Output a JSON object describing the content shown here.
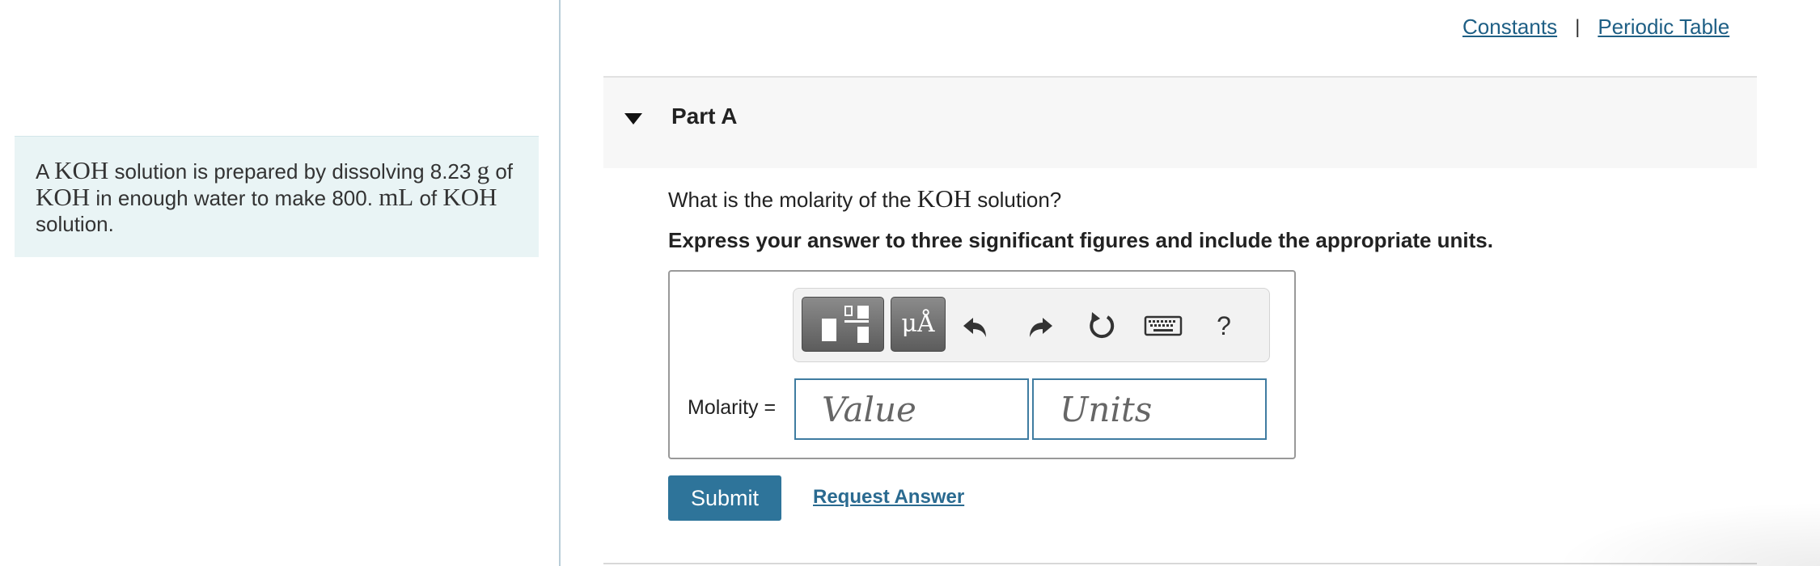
{
  "links": {
    "constants": "Constants",
    "separator": "|",
    "periodic_table": "Periodic Table"
  },
  "problem": {
    "t1": "A ",
    "koh1": "KOH",
    "t2": " solution is prepared by dissolving 8.23 ",
    "unit_g": "g",
    "t3": " of ",
    "koh2": "KOH",
    "t4": " in enough water to make 800. ",
    "unit_ml": "mL",
    "t5": " of ",
    "koh3": "KOH",
    "t6": " solution."
  },
  "part": {
    "title": "Part A"
  },
  "question": {
    "pre": "What is the molarity of the ",
    "math": "KOH",
    "post": " solution?"
  },
  "instruction": "Express your answer to three significant figures and include the appropriate units.",
  "toolbar": {
    "mu_label": "μÅ",
    "help_label": "?"
  },
  "answer": {
    "label": "Molarity =",
    "value_placeholder": "Value",
    "units_placeholder": "Units"
  },
  "actions": {
    "submit": "Submit",
    "request_answer": "Request Answer"
  }
}
